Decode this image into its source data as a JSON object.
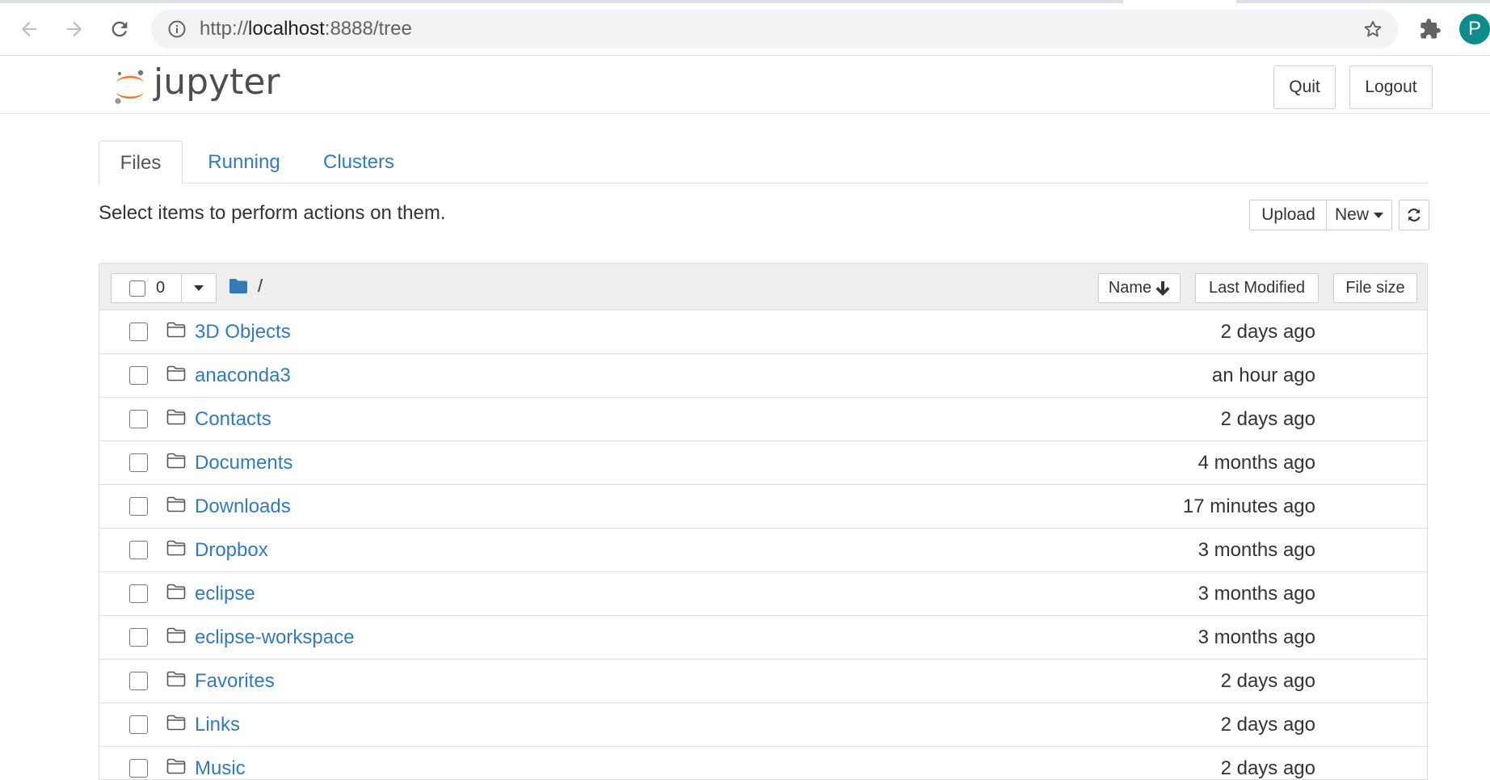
{
  "browser": {
    "url_prefix": "http://",
    "url_host": "localhost",
    "url_rest": ":8888/tree",
    "profile_initial": "P"
  },
  "header": {
    "logo_text": "jupyter",
    "quit_label": "Quit",
    "logout_label": "Logout"
  },
  "tabs": [
    {
      "label": "Files",
      "active": true
    },
    {
      "label": "Running",
      "active": false
    },
    {
      "label": "Clusters",
      "active": false
    }
  ],
  "toolbar": {
    "hint": "Select items to perform actions on them.",
    "upload_label": "Upload",
    "new_label": "New"
  },
  "list_header": {
    "selected_count": "0",
    "breadcrumb": "/",
    "sort_name_label": "Name",
    "sort_modified_label": "Last Modified",
    "sort_size_label": "File size"
  },
  "files": [
    {
      "name": "3D Objects",
      "modified": "2 days ago"
    },
    {
      "name": "anaconda3",
      "modified": "an hour ago"
    },
    {
      "name": "Contacts",
      "modified": "2 days ago"
    },
    {
      "name": "Documents",
      "modified": "4 months ago"
    },
    {
      "name": "Downloads",
      "modified": "17 minutes ago"
    },
    {
      "name": "Dropbox",
      "modified": "3 months ago"
    },
    {
      "name": "eclipse",
      "modified": "3 months ago"
    },
    {
      "name": "eclipse-workspace",
      "modified": "3 months ago"
    },
    {
      "name": "Favorites",
      "modified": "2 days ago"
    },
    {
      "name": "Links",
      "modified": "2 days ago"
    },
    {
      "name": "Music",
      "modified": "2 days ago"
    }
  ],
  "colors": {
    "link": "#337ab7",
    "jupyter_orange": "#f37726",
    "profile_bg": "#0e8c8c"
  }
}
